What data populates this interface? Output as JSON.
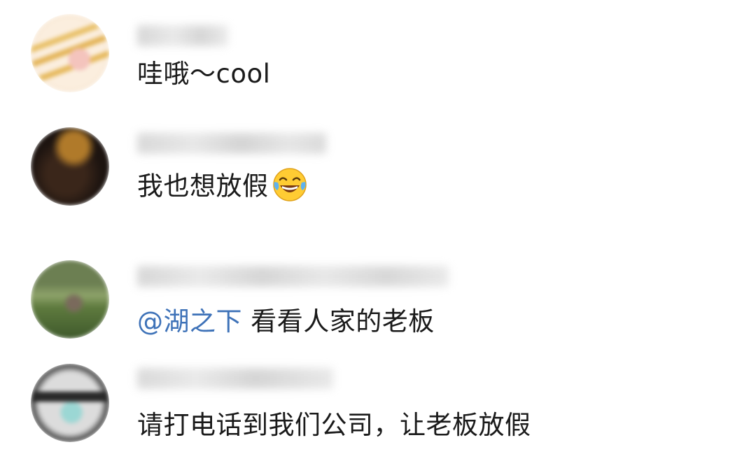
{
  "comments": [
    {
      "username": "",
      "text": "哇哦～cool"
    },
    {
      "username": "",
      "text": "我也想放假",
      "emoji": "laughing-tears-emoji"
    },
    {
      "username": "",
      "mention": "@湖之下",
      "text": " 看看人家的老板"
    },
    {
      "username": "",
      "text": "请打电话到我们公司，让老板放假"
    }
  ],
  "colors": {
    "mention": "#3e72b8",
    "text": "#1a1a1a",
    "background": "#ffffff"
  }
}
